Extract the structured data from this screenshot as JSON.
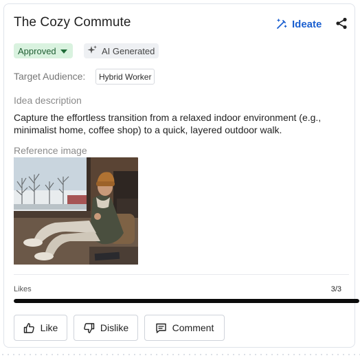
{
  "card": {
    "title": "The Cozy Commute",
    "ideate_label": "Ideate",
    "share_icon": "share-icon",
    "status": {
      "label": "Approved",
      "color": "#d9f2df",
      "text_color": "#1f5e33"
    },
    "ai_badge": {
      "label": "AI Generated",
      "icon": "sparkle-icon"
    },
    "target_audience": {
      "label": "Target Audience:",
      "value": "Hybrid Worker"
    },
    "description": {
      "heading": "Idea description",
      "text": "Capture the effortless transition from a relaxed indoor environment (e.g., minimalist home, coffee shop) to a quick, layered outdoor walk."
    },
    "reference": {
      "heading": "Reference image"
    },
    "likes": {
      "label": "Likes",
      "count": "3/3",
      "progress": 1.0
    },
    "actions": {
      "like": "Like",
      "dislike": "Dislike",
      "comment": "Comment"
    },
    "colors": {
      "accent": "#1a5fd0",
      "progress_fill": "#0b0b0b"
    }
  }
}
